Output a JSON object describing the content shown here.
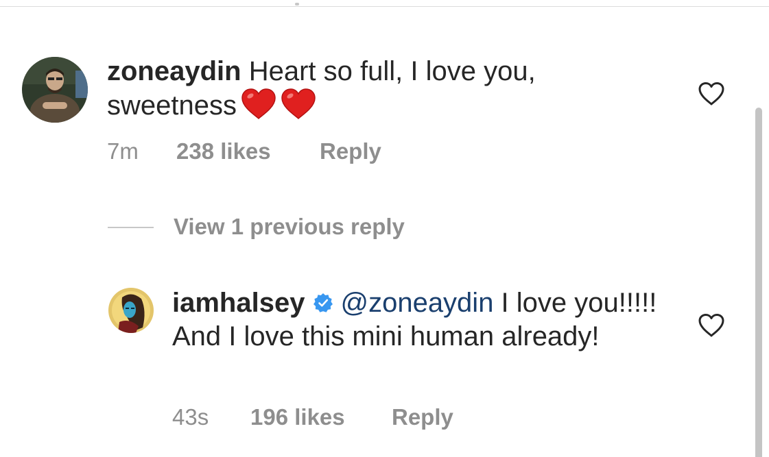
{
  "comments": [
    {
      "username": "zoneaydin",
      "text_line": "Heart so full, I love you,",
      "text_line2": "sweetness",
      "emojis": [
        "red-heart-emoji",
        "red-heart-emoji"
      ],
      "time": "7m",
      "likes": "238 likes",
      "reply_label": "Reply",
      "like_icon": "heart-outline-icon"
    },
    {
      "username": "iamhalsey",
      "verified": true,
      "verified_icon": "verified-badge-icon",
      "mention": "@zoneaydin",
      "text": " I love you!!!!! And I love this mini human already!",
      "time": "43s",
      "likes": "196 likes",
      "reply_label": "Reply",
      "like_icon": "heart-outline-icon"
    }
  ],
  "view_replies_label": "View 1 previous reply",
  "colors": {
    "text": "#262626",
    "secondary": "#8e8e8e",
    "mention": "#1a3f6e",
    "verified": "#3897f0",
    "emoji_heart": "#e0201f"
  }
}
